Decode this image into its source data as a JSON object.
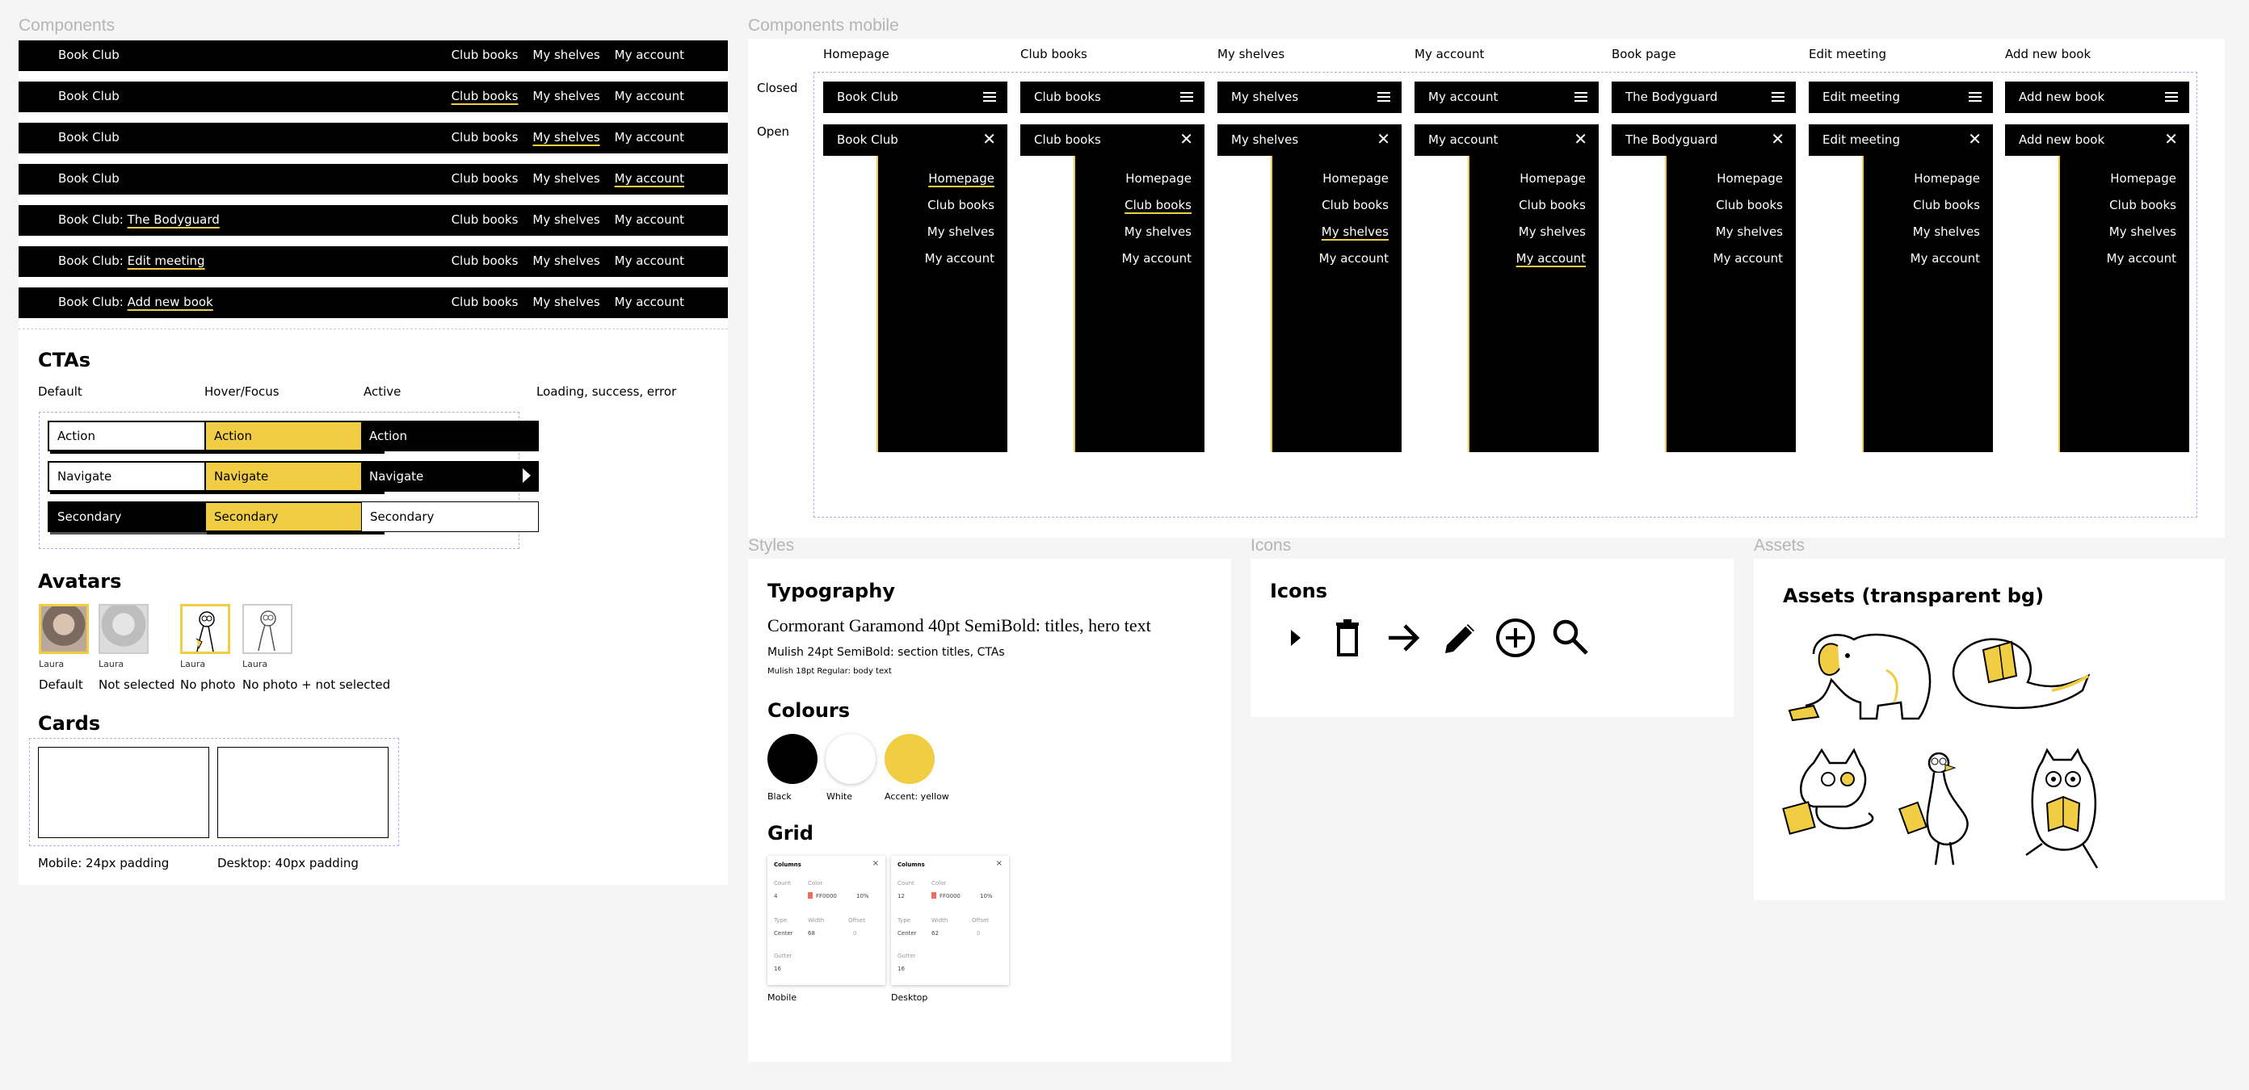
{
  "frames": {
    "components": "Components",
    "components_mobile": "Components mobile",
    "styles": "Styles",
    "icons": "Icons",
    "assets": "Assets"
  },
  "navbars": [
    {
      "brand": "Book Club",
      "brand_link": "",
      "links": [
        "Club books",
        "My shelves",
        "My account"
      ],
      "active": -1
    },
    {
      "brand": "Book Club",
      "brand_link": "",
      "links": [
        "Club books",
        "My shelves",
        "My account"
      ],
      "active": 0
    },
    {
      "brand": "Book Club",
      "brand_link": "",
      "links": [
        "Club books",
        "My shelves",
        "My account"
      ],
      "active": 1
    },
    {
      "brand": "Book Club",
      "brand_link": "",
      "links": [
        "Club books",
        "My shelves",
        "My account"
      ],
      "active": 2
    },
    {
      "brand": "Book Club: ",
      "brand_link": "The Bodyguard",
      "links": [
        "Club books",
        "My shelves",
        "My account"
      ],
      "active": -1
    },
    {
      "brand": "Book Club: ",
      "brand_link": "Edit meeting",
      "links": [
        "Club books",
        "My shelves",
        "My account"
      ],
      "active": -1
    },
    {
      "brand": "Book Club: ",
      "brand_link": "Add new book",
      "links": [
        "Club books",
        "My shelves",
        "My account"
      ],
      "active": -1
    }
  ],
  "ctas": {
    "title": "CTAs",
    "states": [
      "Default",
      "Hover/Focus",
      "Active",
      "Loading, success, error"
    ],
    "action": "Action",
    "navigate": "Navigate",
    "secondary": "Secondary"
  },
  "avatars": {
    "title": "Avatars",
    "name": "Laura",
    "captions": [
      "Default",
      "Not selected",
      "No photo",
      "No photo + not selected"
    ]
  },
  "cards": {
    "title": "Cards",
    "captions": [
      "Mobile: 24px padding",
      "Desktop: 40px padding"
    ]
  },
  "mobile": {
    "row_labels": [
      "Closed",
      "Open"
    ],
    "columns": [
      {
        "head": "Homepage",
        "title": "Book Club",
        "active": 0
      },
      {
        "head": "Club books",
        "title": "Club books",
        "active": 1
      },
      {
        "head": "My shelves",
        "title": "My shelves",
        "active": 2
      },
      {
        "head": "My account",
        "title": "My account",
        "active": 3
      },
      {
        "head": "Book page",
        "title": "The Bodyguard",
        "active": -1
      },
      {
        "head": "Edit meeting",
        "title": "Edit meeting",
        "active": -1
      },
      {
        "head": "Add new book",
        "title": "Add new book",
        "active": -1
      }
    ],
    "menu": [
      "Homepage",
      "Club books",
      "My shelves",
      "My account"
    ]
  },
  "styles": {
    "typography_title": "Typography",
    "type_samples": [
      "Cormorant Garamond 40pt SemiBold: titles, hero text",
      "Mulish 24pt SemiBold: section titles, CTAs",
      "Mulish 18pt Regular: body text"
    ],
    "colours_title": "Colours",
    "colours": [
      {
        "name": "Black",
        "hex": "#000000"
      },
      {
        "name": "White",
        "hex": "#ffffff"
      },
      {
        "name": "Accent: yellow",
        "hex": "#f0cd42"
      }
    ],
    "grid_title": "Grid",
    "grids": [
      {
        "label": "Mobile",
        "header": "Columns",
        "count": "4",
        "color": "FF0000",
        "opacity": "10%",
        "type": "Center",
        "width": "68",
        "offset": "0",
        "gutter": "16"
      },
      {
        "label": "Desktop",
        "header": "Columns",
        "count": "12",
        "color": "FF0000",
        "opacity": "10%",
        "type": "Center",
        "width": "62",
        "offset": "0",
        "gutter": "16"
      }
    ],
    "grid_field_labels": {
      "count": "Count",
      "color": "Color",
      "type": "Type",
      "width": "Width",
      "offset": "Offset",
      "gutter": "Gutter"
    }
  },
  "icons": {
    "title": "Icons",
    "list": [
      "play-icon",
      "trash-icon",
      "arrow-right-icon",
      "pencil-icon",
      "add-circle-icon",
      "search-icon"
    ]
  },
  "assets": {
    "title": "Assets (transparent bg)",
    "list": [
      "elephant-illustration",
      "snake-reading-illustration",
      "cat-reading-illustration",
      "goose-reading-illustration",
      "owl-reading-illustration"
    ]
  }
}
